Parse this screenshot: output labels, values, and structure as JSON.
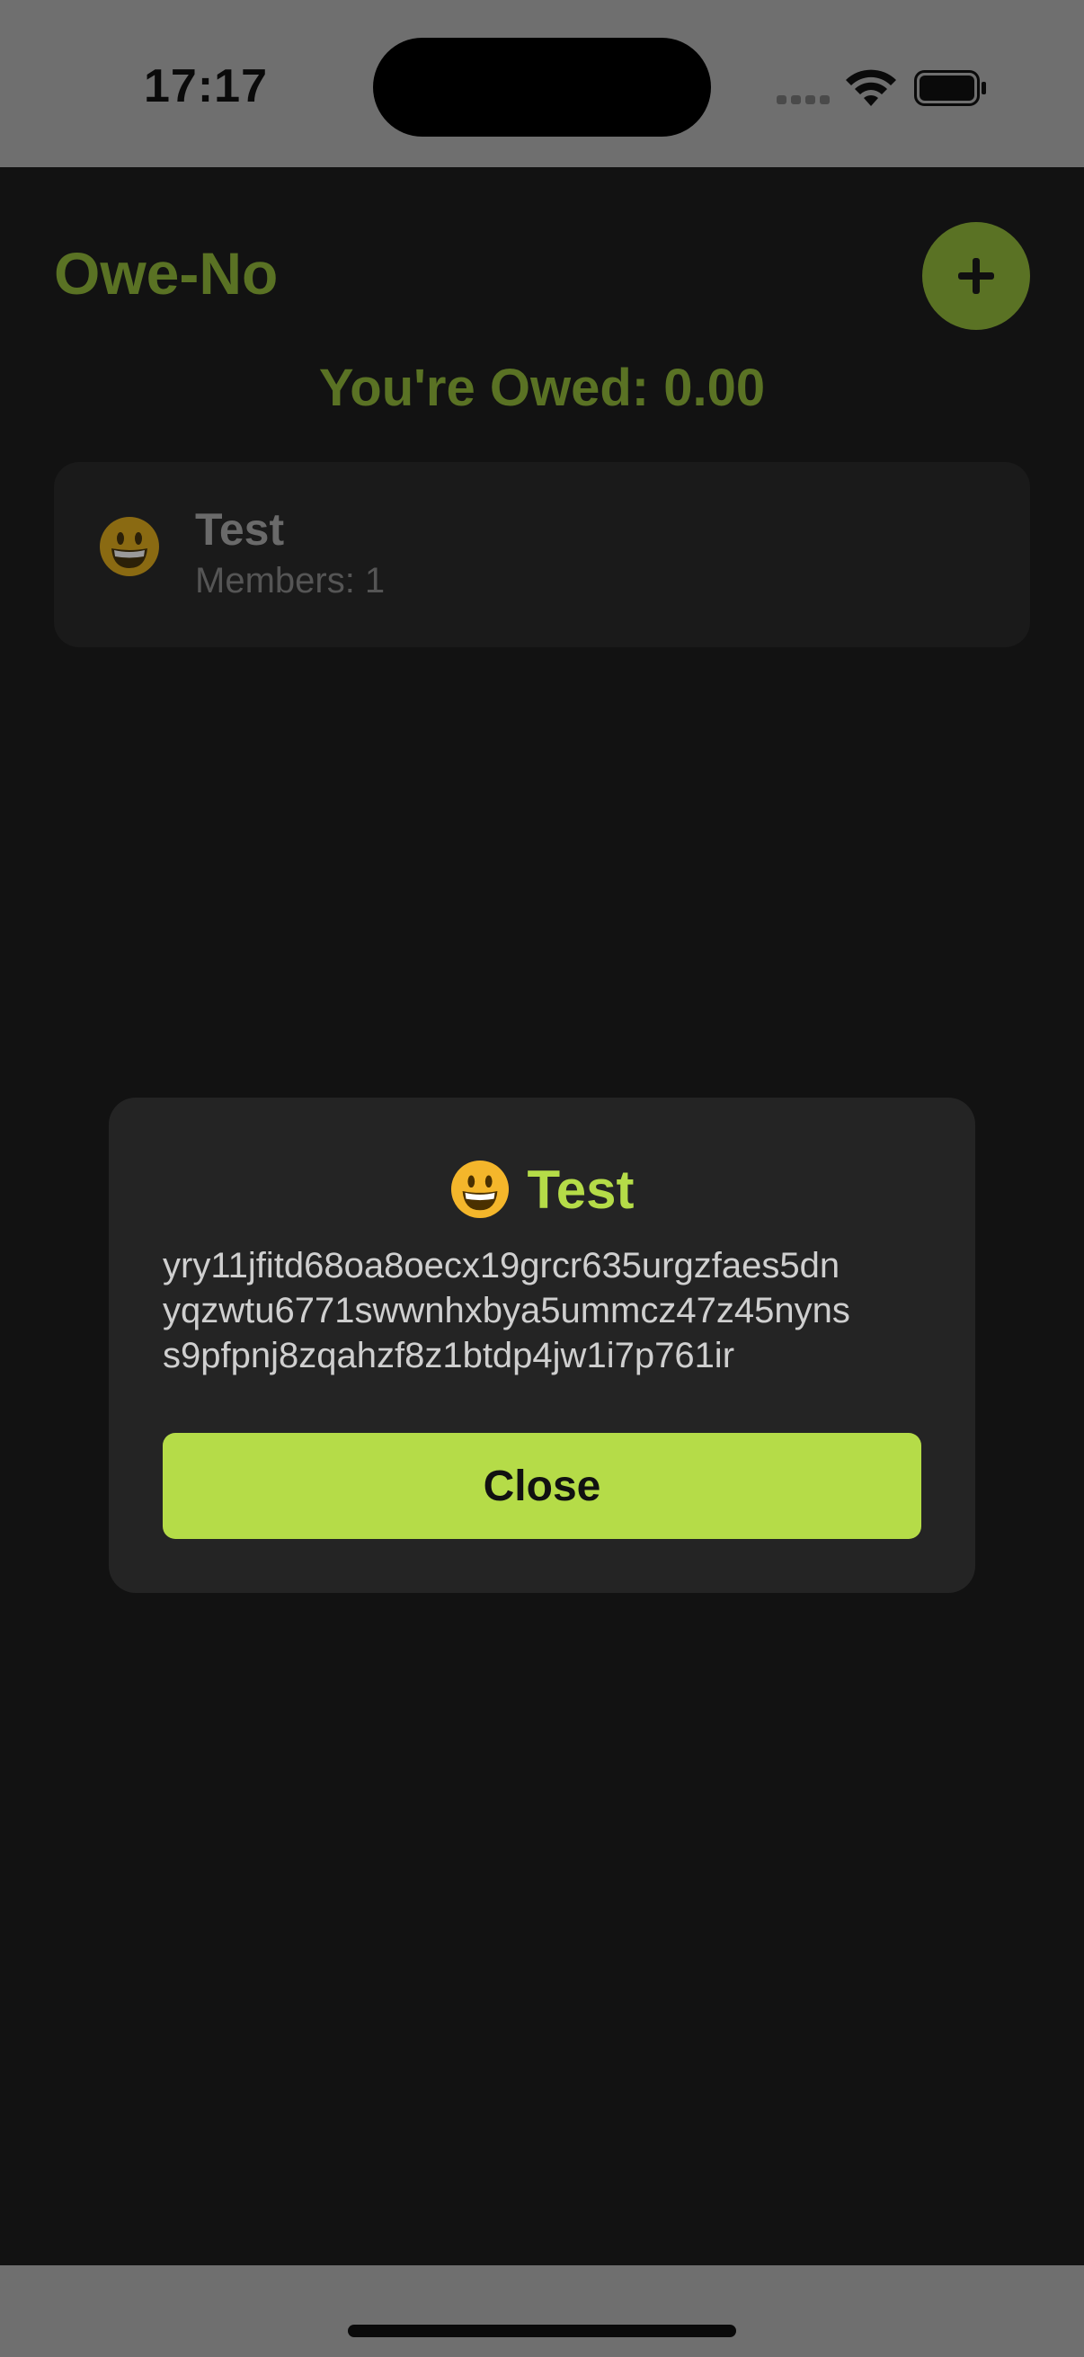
{
  "status_bar": {
    "time": "17:17"
  },
  "header": {
    "title": "Owe-No",
    "add_icon": "plus-icon"
  },
  "summary": {
    "owed_text": "You're Owed: 0.00"
  },
  "groups": [
    {
      "icon": "grinning-face-emoji",
      "name": "Test",
      "members": "Members: 1"
    }
  ],
  "modal": {
    "icon": "grinning-face-emoji",
    "title": "Test",
    "code_lines": [
      "yry11jfitd68oa8oecx19grcr635urgzfaes5dn",
      "yqzwtu6771swwnhxbya5ummcz47z45nyns",
      "s9pfpnj8zqahzf8z1btdp4jw1i7p761ir"
    ],
    "close_label": "Close"
  },
  "colors": {
    "accent": "#b5dc48",
    "accent_dimmed": "#5a7224",
    "background": "#121212",
    "modal_background": "#242424"
  }
}
